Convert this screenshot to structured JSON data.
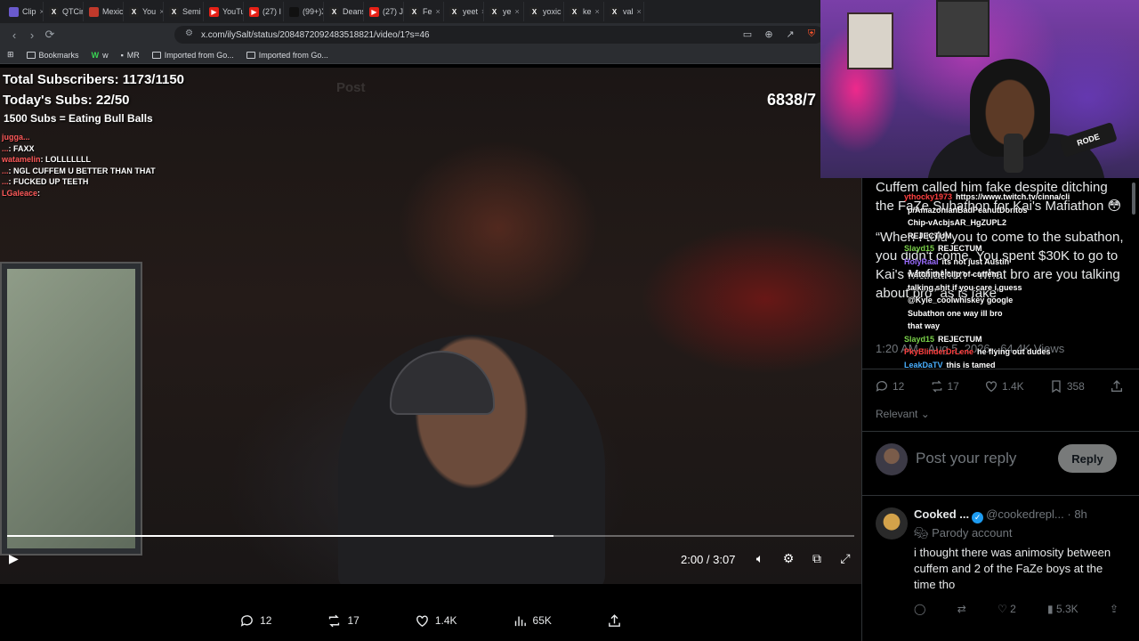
{
  "browser": {
    "tabs": [
      {
        "label": "Clip",
        "icon": "clip-icon",
        "color": "#6a5acd"
      },
      {
        "label": "QTCin",
        "icon": "x-icon",
        "color": "#222222"
      },
      {
        "label": "Mexic",
        "icon": "record-icon",
        "color": "#c0392b"
      },
      {
        "label": "You",
        "icon": "x-icon",
        "color": "#222222"
      },
      {
        "label": "Semi",
        "icon": "x-icon",
        "color": "#222222"
      },
      {
        "label": "YouTul",
        "icon": "youtube-icon",
        "color": "#e62117"
      },
      {
        "label": "(27) I",
        "icon": "youtube-icon",
        "color": "#e62117"
      },
      {
        "label": "(99+)X",
        "icon": "tiktok-icon",
        "color": "#111111"
      },
      {
        "label": "Deans",
        "icon": "x-icon",
        "color": "#222222"
      },
      {
        "label": "(27) Jir",
        "icon": "youtube-icon",
        "color": "#e62117"
      },
      {
        "label": "Fe",
        "icon": "x-icon",
        "color": "#222222"
      },
      {
        "label": "yeet",
        "icon": "x-icon",
        "color": "#222222"
      },
      {
        "label": "ye",
        "icon": "x-icon",
        "color": "#222222"
      },
      {
        "label": "yoxic",
        "icon": "x-icon",
        "color": "#222222"
      },
      {
        "label": "ke",
        "icon": "x-icon",
        "color": "#222222"
      },
      {
        "label": "val",
        "icon": "x-icon",
        "color": "#222222"
      }
    ],
    "url": "x.com/ilySalt/status/2084872092483518821/video/1?s=46",
    "bookmarks": [
      {
        "label": "Bookmarks"
      },
      {
        "label": "w"
      },
      {
        "label": "MR"
      },
      {
        "label": "Imported from Go..."
      },
      {
        "label": "Imported from Go..."
      }
    ]
  },
  "stream_overlay": {
    "total_subs": "Total Subscribers: 1173/1150",
    "today_subs": "Today's Subs: 22/50",
    "goal": "1500 Subs = Eating Bull Balls",
    "counter": "6838/7",
    "left_chat": [
      {
        "user": "jugga...",
        "msg": ""
      },
      {
        "user": "...",
        "msg": ": FAXX"
      },
      {
        "user": "watamelin",
        "msg": ": LOLLLLLLL"
      },
      {
        "user": "...",
        "msg": ": NGL CUFFEM U BETTER THAN THAT"
      },
      {
        "user": "...",
        "msg": ": FUCKED UP TEETH"
      },
      {
        "user": "LGaleace",
        "msg": ":"
      }
    ],
    "right_chat": [
      {
        "user": "ythocky1973",
        "msg": "https://www.twitch.tv/cinna/cli",
        "color": "#ff4040"
      },
      {
        "user": "",
        "msg": "p/AmazonianBadPeanutDoritos",
        "color": "#ff4040"
      },
      {
        "user": "",
        "msg": "Chip-vAcbjsAR_HgZUPL2",
        "color": "#ff4040"
      },
      {
        "user": "",
        "msg": "REJECTUM",
        "color": "#ff4040"
      },
      {
        "user": "Slayd15",
        "msg": "REJECTUM",
        "color": "#7bd24a"
      },
      {
        "user": "HolyRaal",
        "msg": "its not just Austin",
        "color": "#9b6cff"
      },
      {
        "user": "",
        "msg": "watch the clip of cuffem",
        "color": "#ff4040"
      },
      {
        "user": "",
        "msg": "talking shit if you care i guess",
        "color": "#ff4040"
      },
      {
        "user": "",
        "msg": "@Kyle_coolwhiskey google",
        "color": "#ff4040"
      },
      {
        "user": "",
        "msg": "Subathon one way ill bro",
        "color": "#ff4040"
      },
      {
        "user": "",
        "msg": "that way",
        "color": "#ff4040"
      },
      {
        "user": "Slayd15",
        "msg": "REJECTUM",
        "color": "#7bd24a"
      },
      {
        "user": "PkyBlinderDrLene",
        "msg": "he flying out dudes",
        "color": "#ff4040"
      },
      {
        "user": "LeakDaTV",
        "msg": "this is tamed",
        "color": "#4ab0ff"
      }
    ]
  },
  "video": {
    "post_label": "Post",
    "time": "2:00 / 3:07",
    "progress": 0.645
  },
  "bottom_actions": {
    "replies": "12",
    "reposts": "17",
    "likes": "1.4K",
    "views": "65K"
  },
  "tweet": {
    "text1": "Cuffem called him fake despite ditching the FaZe Subathon for Kai's Mafiathon 😳",
    "text2": "“When I told you to come to the subathon, you didn't come. You spent $30K to go to Kai's Mafiathon - what bro are you talking about bro” as is fake”",
    "time": "1:20 AM · Aug 5, 2026 · 64.4K Views",
    "replies": "12",
    "reposts": "17",
    "likes": "1.4K",
    "bookmarks": "358",
    "relevant": "Relevant"
  },
  "reply_box": {
    "placeholder": "Post your reply",
    "button": "Reply"
  },
  "comment": {
    "name": "Cooked ...",
    "handle": "@cookedrepl...",
    "time": "· 8h",
    "parody": "Parody account",
    "text": "i thought there was animosity between cuffem and 2 of the FaZe boys at the time tho",
    "likes": "2",
    "views": "5.3K"
  },
  "webcam": {
    "mic_brand": "RODE"
  }
}
